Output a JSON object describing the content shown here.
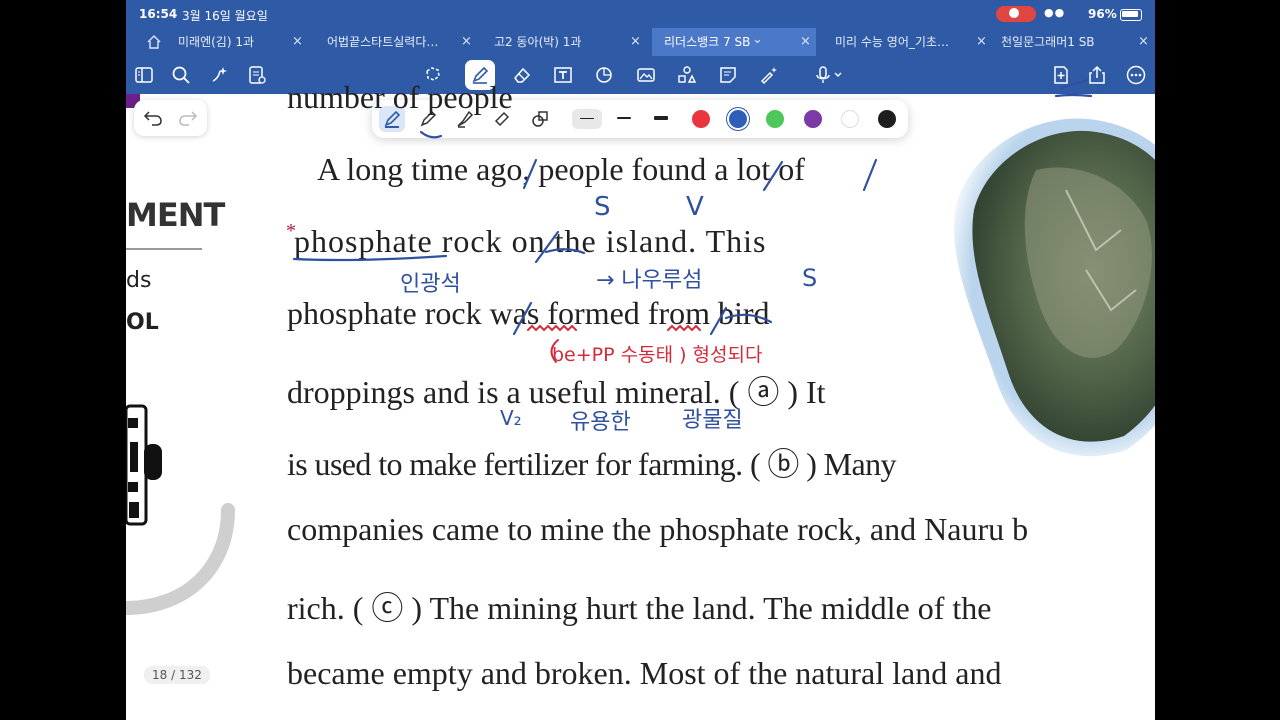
{
  "status": {
    "time": "16:54",
    "date": "3월 16일 월요일",
    "battery": "96%"
  },
  "tabs": [
    {
      "label": "미래엔(김) 1과",
      "active": false
    },
    {
      "label": "어법끝스타트실력다…",
      "active": false
    },
    {
      "label": "고2 동아(박) 1과",
      "active": false
    },
    {
      "label": "리더스뱅크 7 SB",
      "active": true
    },
    {
      "label": "미리 수능 영어_기초…",
      "active": false
    },
    {
      "label": "천일문그래머1 SB",
      "active": false
    }
  ],
  "tab_close": "×",
  "tab_chevron": "⌄",
  "page_indicator": "18 / 132",
  "left_page": {
    "heading": "MENT",
    "line1": "ds",
    "line2": "OL"
  },
  "colors": {
    "toolbar": "#2f5aa6",
    "pen_blue": "#2f51a0",
    "pen_red": "#d22c3a"
  },
  "palette_colors": [
    "#e8353e",
    "#2f5fb8",
    "#4cc85a",
    "#7b3aa6",
    "#ffffff",
    "#1e1e1e"
  ],
  "text_lines": [
    "number of people",
    "A long time ago, people found a lot of",
    "phosphate rock on the island. This",
    "phosphate rock was formed from bird",
    "droppings and is a useful mineral. ( ⓐ ) It",
    "is used to make fertilizer for farming. ( ⓑ ) Many",
    "companies came to mine the phosphate rock, and Nauru b",
    "rich. ( ⓒ ) The mining hurt the land. The middle of the",
    "became empty and broken. Most of the natural land and"
  ],
  "asterisk": "*",
  "annotations": {
    "s1": "S",
    "v1": "V",
    "inkwangseok": "인광석",
    "arrow_nauru": "→ 나우루섬",
    "s2": "S",
    "v_mark": "V",
    "bepp": "be+PP 수동태 ) 형성되다",
    "v2": "V₂",
    "useful": "유용한",
    "mineral": "광물질"
  }
}
